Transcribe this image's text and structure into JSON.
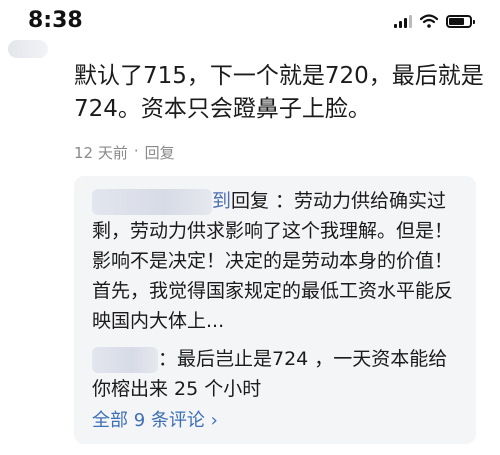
{
  "status_bar": {
    "time": "8:38",
    "signal_bars": 3,
    "battery_level": 0.85
  },
  "comment": {
    "text": "默认了715，下一个就是720，最后就是724。资本只会蹬鼻子上脸。",
    "time_ago": "12 天前",
    "separator": "·",
    "reply_label": "回复"
  },
  "replies": {
    "items": [
      {
        "name_suffix": "到",
        "text": "回复 ：劳动力供给确实过剩，劳动力供求影响了这个我理解。但是！影响不是决定！决定的是劳动本身的价值！首先，我觉得国家规定的最低工资水平能反映国内大体上..."
      },
      {
        "name_suffix": "",
        "text": "：最后岂止是724 ，一天资本能给你榕出来 25 个小时"
      }
    ],
    "view_all": "全部 9 条评论 ›"
  },
  "colors": {
    "link": "#3d6fb6",
    "meta": "#8a8a8a",
    "reply_bg": "#f4f5f7"
  }
}
